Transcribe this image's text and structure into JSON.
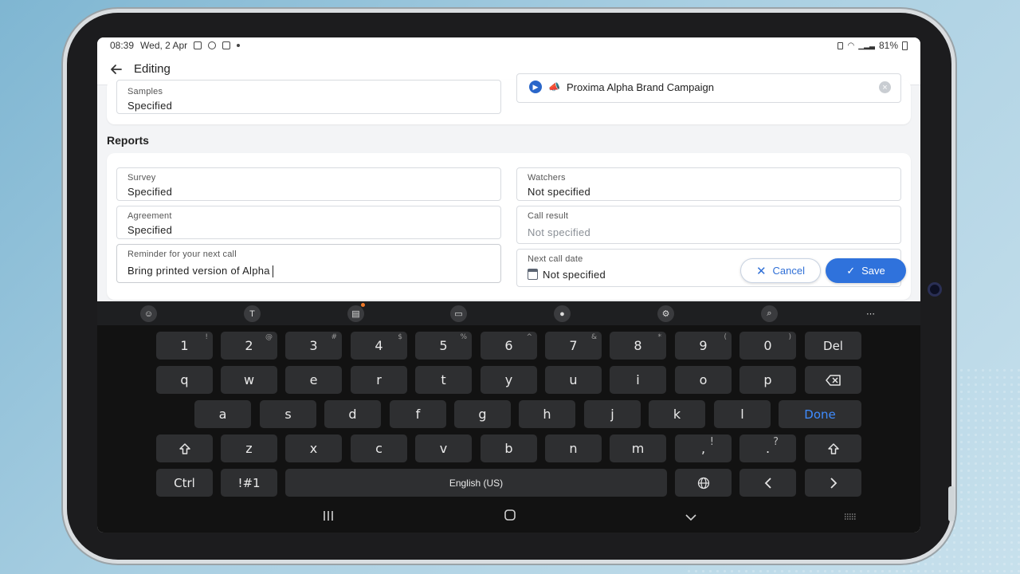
{
  "status": {
    "time": "08:39",
    "date": "Wed, 2 Apr",
    "battery": "81%"
  },
  "appbar": {
    "title": "Editing"
  },
  "fields_top": {
    "samples_label": "Samples",
    "samples_value": "Specified",
    "campaign_value": "Proxima Alpha Brand Campaign"
  },
  "reports": {
    "title": "Reports",
    "survey_label": "Survey",
    "survey_value": "Specified",
    "agreement_label": "Agreement",
    "agreement_value": "Specified",
    "reminder_label": "Reminder for your next call",
    "reminder_value": "Bring printed version of Alpha",
    "watchers_label": "Watchers",
    "watchers_value": "Not specified",
    "callresult_label": "Call result",
    "callresult_value": "Not specified",
    "nextcall_label": "Next call date",
    "nextcall_value": "Not specified"
  },
  "actions": {
    "cancel": "Cancel",
    "save": "Save"
  },
  "keyboard": {
    "row1": [
      {
        "k": "1",
        "s": "!"
      },
      {
        "k": "2",
        "s": "@"
      },
      {
        "k": "3",
        "s": "#"
      },
      {
        "k": "4",
        "s": "$"
      },
      {
        "k": "5",
        "s": "%"
      },
      {
        "k": "6",
        "s": "^"
      },
      {
        "k": "7",
        "s": "&"
      },
      {
        "k": "8",
        "s": "*"
      },
      {
        "k": "9",
        "s": "("
      },
      {
        "k": "0",
        "s": ")"
      },
      {
        "k": "Del",
        "s": ""
      }
    ],
    "row2": [
      "q",
      "w",
      "e",
      "r",
      "t",
      "y",
      "u",
      "i",
      "o",
      "p"
    ],
    "row3": [
      "a",
      "s",
      "d",
      "f",
      "g",
      "h",
      "j",
      "k",
      "l"
    ],
    "done": "Done",
    "row4": [
      "z",
      "x",
      "c",
      "v",
      "b",
      "n",
      "m"
    ],
    "comma": ",",
    "comma_sup": "!",
    "period": ".",
    "period_sup": "?",
    "ctrl": "Ctrl",
    "symbols": "!#1",
    "space": "English (US)"
  },
  "icons": {
    "back": "arrow-left-icon",
    "keyboard_toolbar": [
      "emoji-icon",
      "handwriting-icon",
      "clipboard-icon",
      "mode-icon",
      "mic-icon",
      "settings-icon",
      "search-icon",
      "more-icon"
    ]
  },
  "colors": {
    "accent": "#2f72dc",
    "keyboard_bg": "#121212",
    "done_key": "#3f8cff"
  }
}
